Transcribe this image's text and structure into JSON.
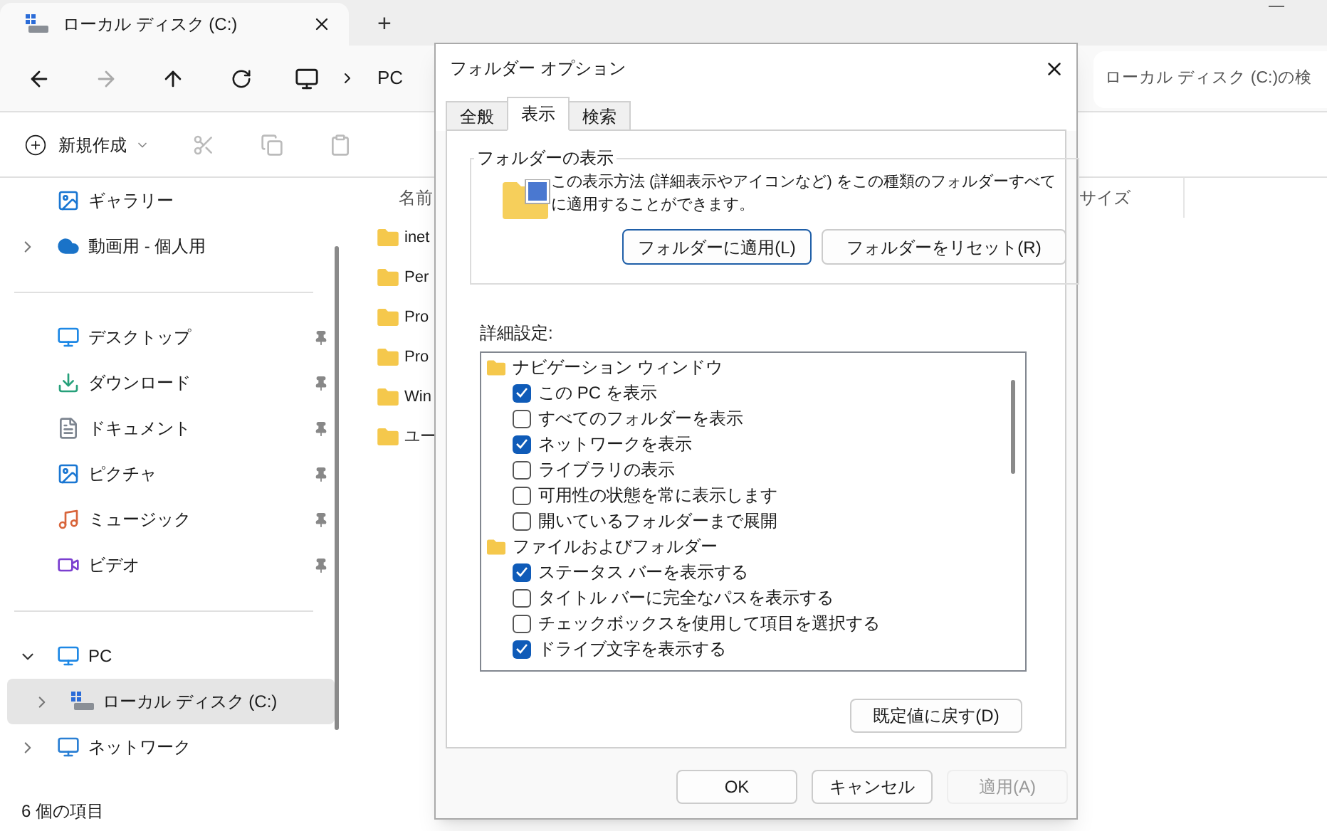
{
  "explorer": {
    "tab": {
      "title": "ローカル ディスク (C:)"
    },
    "new_tab": "+",
    "address": {
      "crumbs": [
        "PC"
      ]
    },
    "search": {
      "placeholder": "ローカル ディスク (C:)の検"
    },
    "toolbar": {
      "new_label": "新規作成"
    },
    "sidebar": {
      "sections": [
        {
          "items": [
            {
              "label": "ギャラリー",
              "selected": false
            },
            {
              "label": "動画用 - 個人用",
              "selected": false,
              "expanded": false
            }
          ]
        },
        {
          "items": [
            {
              "label": "デスクトップ",
              "selected": false,
              "pinned": true
            },
            {
              "label": "ダウンロード",
              "selected": false,
              "pinned": true
            },
            {
              "label": "ドキュメント",
              "selected": false,
              "pinned": true
            },
            {
              "label": "ピクチャ",
              "selected": false,
              "pinned": true
            },
            {
              "label": "ミュージック",
              "selected": false,
              "pinned": true
            },
            {
              "label": "ビデオ",
              "selected": false,
              "pinned": true
            }
          ]
        },
        {
          "items": [
            {
              "label": "PC",
              "selected": false,
              "expanded": true,
              "children": [
                {
                  "label": "ローカル ディスク (C:)",
                  "selected": true,
                  "expanded": false
                }
              ]
            },
            {
              "label": "ネットワーク",
              "selected": false,
              "expanded": false
            }
          ]
        }
      ]
    },
    "columns": [
      "名前",
      "サイズ"
    ],
    "files": [
      "inet",
      "Per",
      "Pro",
      "Pro",
      "Win",
      "ユー"
    ],
    "status_bar": "6 個の項目"
  },
  "dialog": {
    "title": "フォルダー オプション",
    "tabs": [
      {
        "label": "全般",
        "selected": false
      },
      {
        "label": "表示",
        "selected": true
      },
      {
        "label": "検索",
        "selected": false
      }
    ],
    "folder_view": {
      "legend": "フォルダーの表示",
      "description": "この表示方法 (詳細表示やアイコンなど) をこの種類のフォルダーすべてに適用することができます。",
      "buttons": [
        {
          "label": "フォルダーに適用(L)",
          "default": true
        },
        {
          "label": "フォルダーをリセット(R)",
          "default": false
        }
      ]
    },
    "advanced_label": "詳細設定:",
    "settings": [
      {
        "label": "ナビゲーション ウィンドウ",
        "children": [
          {
            "label": "この PC を表示",
            "checked": true
          },
          {
            "label": "すべてのフォルダーを表示",
            "checked": false
          },
          {
            "label": "ネットワークを表示",
            "checked": true
          },
          {
            "label": "ライブラリの表示",
            "checked": false
          },
          {
            "label": "可用性の状態を常に表示します",
            "checked": false
          },
          {
            "label": "開いているフォルダーまで展開",
            "checked": false
          }
        ]
      },
      {
        "label": "ファイルおよびフォルダー",
        "children": [
          {
            "label": "ステータス バーを表示する",
            "checked": true
          },
          {
            "label": "タイトル バーに完全なパスを表示する",
            "checked": false
          },
          {
            "label": "チェックボックスを使用して項目を選択する",
            "checked": false
          },
          {
            "label": "ドライブ文字を表示する",
            "checked": true
          }
        ]
      }
    ],
    "restore_button": {
      "label": "既定値に戻す(D)",
      "disabled": false
    },
    "footer_buttons": [
      {
        "label": "OK",
        "disabled": false
      },
      {
        "label": "キャンセル",
        "disabled": false
      },
      {
        "label": "適用(A)",
        "disabled": true
      }
    ]
  }
}
